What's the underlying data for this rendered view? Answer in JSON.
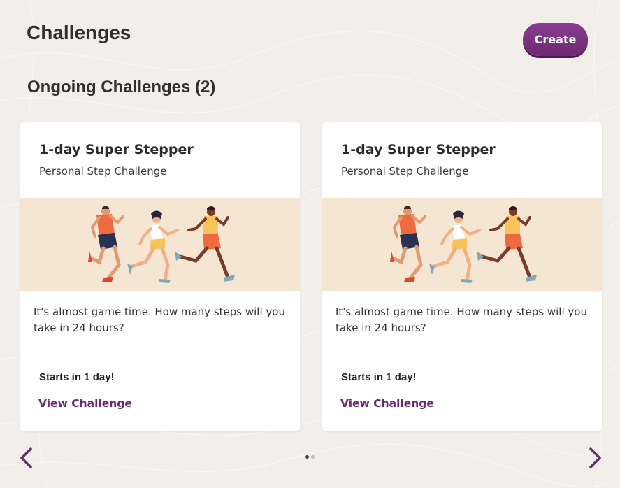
{
  "header": {
    "title": "Challenges",
    "create_label": "Create"
  },
  "section": {
    "title": "Ongoing Challenges (2)"
  },
  "cards": [
    {
      "title": "1-day Super Stepper",
      "subtitle": "Personal Step Challenge",
      "description": "It's almost game time. How many steps will you take in 24 hours?",
      "start": "Starts in 1 day!",
      "link": "View Challenge",
      "illustration": "three-runners-illustration"
    },
    {
      "title": "1-day Super Stepper",
      "subtitle": "Personal Step Challenge",
      "description": "It's almost game time. How many steps will you take in 24 hours?",
      "start": "Starts in 1 day!",
      "link": "View Challenge",
      "illustration": "three-runners-illustration"
    }
  ],
  "carousel": {
    "pages": 2,
    "active_page": 1,
    "prev_icon": "chevron-left-icon",
    "next_icon": "chevron-right-icon"
  },
  "colors": {
    "accent": "#6b2a6e",
    "background": "#f2efea",
    "banner": "#f4e6d3"
  }
}
